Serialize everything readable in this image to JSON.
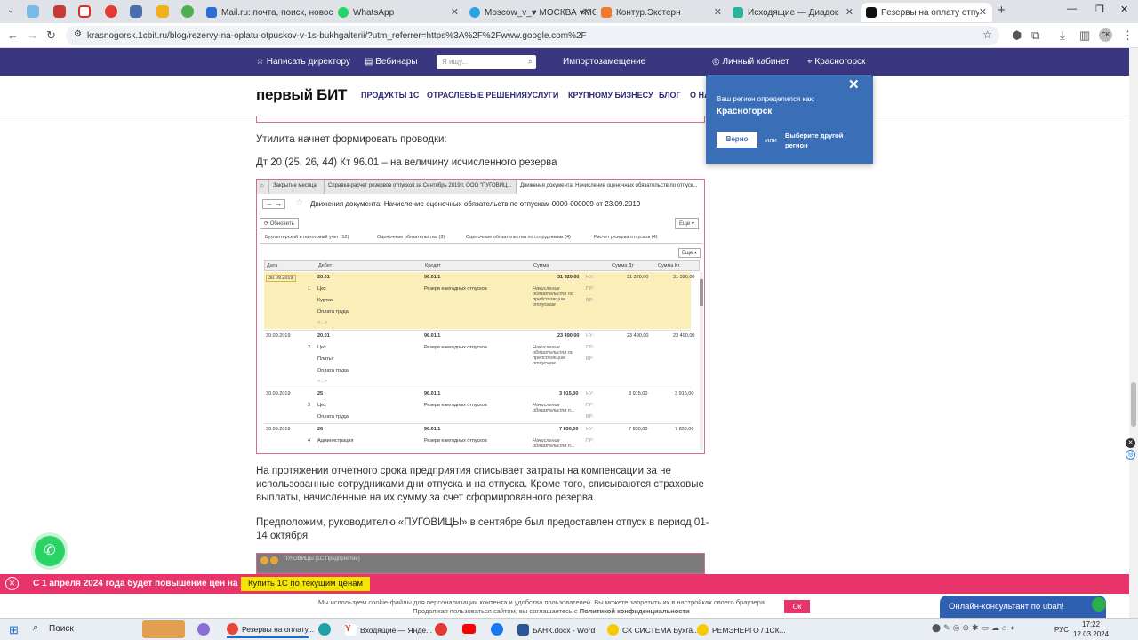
{
  "browser": {
    "tabs": [
      {
        "label": "Mail.ru: почта, поиск, новости...",
        "color": "#2c6dd6"
      },
      {
        "label": "WhatsApp",
        "color": "#25d366"
      },
      {
        "label": "Moscow_v_♥ МОСКВА ♥МС",
        "color": "#2aa3e0"
      },
      {
        "label": "Контур.Экстерн",
        "color": "#f07a2d"
      },
      {
        "label": "Исходящие — Диадок",
        "color": "#2bb39a"
      },
      {
        "label": "Резервы на оплату отпусков в",
        "color": "#111111"
      }
    ],
    "url": "krasnogorsk.1cbit.ru/blog/rezervy-na-oplatu-otpuskov-v-1s-bukhgalterii/?utm_referrer=https%3A%2F%2Fwww.google.com%2F",
    "profile": "CK"
  },
  "topbar": {
    "write_director": "Написать директору",
    "webinars": "Вебинары",
    "search_placeholder": "Я ищу...",
    "import": "Импортозамещение",
    "cabinet": "Личный кабинет",
    "city": "Красногорск"
  },
  "nav": {
    "logo": "первый БИТ",
    "items": [
      "ПРОДУКТЫ 1С",
      "ОТРАСЛЕВЫЕ РЕШЕНИЯ",
      "УСЛУГИ",
      "КРУПНОМУ БИЗНЕСУ",
      "БЛОГ",
      "О НА"
    ]
  },
  "popup": {
    "text": "Ваш регион определился как:",
    "region": "Красногорск",
    "yes": "Верно",
    "or": "или",
    "other": "Выберите другой регион"
  },
  "article": {
    "p1": "Утилита начнет формировать проводки:",
    "p2": "Дт 20 (25, 26, 44) Кт 96.01 – на величину исчисленного резерва",
    "p3": "На протяжении отчетного срока предприятия списывает затраты на компенсации за не использованные сотрудниками дни отпуска и на отпуска. Кроме того, списываются страховые выплаты, начисленные на их сумму за счет сформированного резерва.",
    "p4": "Предположим, руководителю «ПУГОВИЦЫ» в сентябре был предоставлен отпуск в период 01-14 октября"
  },
  "shot": {
    "tabs": [
      "Закрытие месяца",
      "Справка-расчет резервов отпусков за Сентябрь 2019 г. ООО \"ПУГОВИЦ...",
      "Движения документа: Начисление оценочных обязательств по отпуск..."
    ],
    "title": "Движения документа: Начисление оценочных обязательств по отпускам 0000-000009 от 23.09.2019",
    "refresh": "Обновить",
    "more": "Еще",
    "subtabs": [
      "Бухгалтерский и налоговый учет (12)",
      "Оценочные обязательства (3)",
      "Оценочные обязательства по сотрудникам (4)",
      "Расчет резерва отпусков (4)"
    ],
    "headers": [
      "Дата",
      "Дебет",
      "Кредит",
      "Сумма",
      "",
      "Сумма Дт",
      "Сумма Кт"
    ],
    "rows": [
      {
        "date": "30.09.2019",
        "n": "1",
        "debit": [
          "20.01",
          "Цех",
          "Куртки",
          "Оплата труда",
          "<...>"
        ],
        "credit": [
          "96.01.1",
          "Резерв ежегодных отпусков"
        ],
        "sum": "31 320,00",
        "desc": "Начисление обязательств по предстоящим отпускам",
        "nu": "31 320,00",
        "kt": "31 320,00"
      },
      {
        "date": "30.09.2019",
        "n": "2",
        "debit": [
          "20.01",
          "Цех",
          "Платья",
          "Оплата труда",
          "<...>"
        ],
        "credit": [
          "96.01.1",
          "Резерв ежегодных отпусков"
        ],
        "sum": "23 490,00",
        "desc": "Начисление обязательств по предстоящим отпускам",
        "nu": "23 490,00",
        "kt": "23 490,00"
      },
      {
        "date": "30.09.2019",
        "n": "3",
        "debit": [
          "25",
          "Цех",
          "Оплата труда"
        ],
        "credit": [
          "96.01.1",
          "Резерв ежегодных отпусков"
        ],
        "sum": "3 915,00",
        "desc": "Начисление обязательств п...",
        "nu": "3 915,00",
        "kt": "3 915,00"
      },
      {
        "date": "30.09.2019",
        "n": "4",
        "debit": [
          "26",
          "Администрация"
        ],
        "credit": [
          "96.01.1",
          "Резерв ежегодных отпусков"
        ],
        "sum": "7 830,00",
        "desc": "Начисление обязательств п...",
        "nu": "7 830,00",
        "kt": "7 830,00"
      }
    ],
    "labels": {
      "nu": "НУ:",
      "pr": "ПР:",
      "vr": "ВР:"
    }
  },
  "next_shot_title": "ПУГОВИЦЫ (1С:Предприятие)",
  "promo": {
    "text": "С 1 апреля 2024 года будет повышение цен на 1С",
    "button": "Купить 1С по текущим ценам"
  },
  "cookie": {
    "line1": "Мы используем cookie-файлы для персонализации контента и удобства пользователей. Вы можете запретить их в настройках своего браузера.",
    "line2": "Продолжая пользоваться сайтом, вы соглашаетесь с",
    "link": "Политикой конфиденциальности",
    "ok": "Ок"
  },
  "chat": {
    "label": "Онлайн-консультант поubah!"
  },
  "taskbar": {
    "search": "Поиск",
    "apps": [
      "Резервы на оплату...",
      "Входящие — Янде...",
      "БАНК.docx - Word",
      "СК СИСТЕМА Бухга...",
      "РЕМЭНЕРГО / 1СК..."
    ],
    "lang": "РУС",
    "time": "17:22",
    "date": "12.03.2024"
  }
}
